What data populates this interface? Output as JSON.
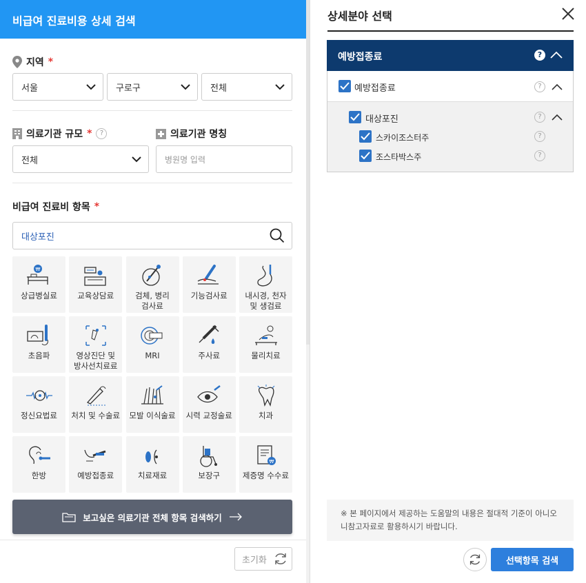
{
  "left": {
    "header_title": "비급여 진료비용 상세 검색",
    "region": {
      "label": "지역",
      "required_mark": "*",
      "city": "서울",
      "district": "구로구",
      "dong": "전체"
    },
    "size": {
      "label": "의료기관 규모",
      "required_mark": "*",
      "help": "?",
      "value": "전체"
    },
    "name": {
      "label": "의료기관 명칭",
      "placeholder": "병원명 입력"
    },
    "items": {
      "label": "비급여 진료비 항목",
      "required_mark": "*",
      "search_value": "대상포진"
    },
    "categories": [
      {
        "label": "상급병실료",
        "icon": "bed-icon"
      },
      {
        "label": "교육상담료",
        "icon": "counseling-icon"
      },
      {
        "label": "검체, 병리\n검사료",
        "icon": "lab-icon"
      },
      {
        "label": "기능검사료",
        "icon": "function-test-icon"
      },
      {
        "label": "내시경, 천자\n및 생검료",
        "icon": "endoscope-icon"
      },
      {
        "label": "초음파",
        "icon": "ultrasound-icon"
      },
      {
        "label": "영상진단 및\n방사선치료료",
        "icon": "radiology-icon"
      },
      {
        "label": "MRI",
        "icon": "mri-icon"
      },
      {
        "label": "주사료",
        "icon": "syringe-icon"
      },
      {
        "label": "물리치료",
        "icon": "physio-icon"
      },
      {
        "label": "정신요법료",
        "icon": "brain-wave-icon"
      },
      {
        "label": "처치 및 수술료",
        "icon": "surgery-icon"
      },
      {
        "label": "모발 이식술료",
        "icon": "hair-icon"
      },
      {
        "label": "시력 교정술료",
        "icon": "eye-icon"
      },
      {
        "label": "치과",
        "icon": "tooth-icon"
      },
      {
        "label": "한방",
        "icon": "acupuncture-icon"
      },
      {
        "label": "예방접종료",
        "icon": "vaccine-icon"
      },
      {
        "label": "치료재료",
        "icon": "material-icon"
      },
      {
        "label": "보장구",
        "icon": "wheelchair-icon"
      },
      {
        "label": "제증명 수수료",
        "icon": "certificate-icon"
      }
    ],
    "search_all_button": "보고싶은 의료기관 전체 항목 검색하기",
    "reset_button": "초기화"
  },
  "right": {
    "title": "상세분야 선택",
    "category_header": "예방접종료",
    "help_mark": "?",
    "tree": {
      "level1": "예방접종료",
      "level2": "대상포진",
      "leaves": [
        "스카이조스터주",
        "조스타박스주"
      ]
    },
    "notice": "※ 본 페이지에서 제공하는 도움말의 내용은 절대적 기준이 아니오니참고자료로 활용하시기 바랍니다.",
    "submit_button": "선택항목 검색"
  },
  "colors": {
    "header_blue": "#2196f3",
    "navy": "#0d3a6e",
    "checkbox_blue": "#2d73c6",
    "primary_blue": "#2d7fdd",
    "dark_button": "#5b6271",
    "required_red": "#e53935"
  }
}
